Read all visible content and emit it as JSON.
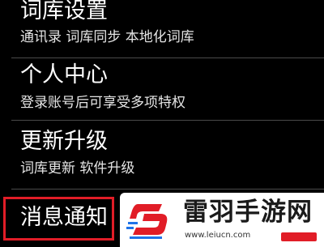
{
  "settings": {
    "dictionary": {
      "title": "词库设置",
      "subtitle": "通讯录 词库同步 本地化词库"
    },
    "personal_center": {
      "title": "个人中心",
      "subtitle": "登录账号后可享受多项特权"
    },
    "update": {
      "title": "更新升级",
      "subtitle": "词库更新 软件升级"
    },
    "notifications": {
      "title": "消息通知"
    }
  },
  "watermark": {
    "logo_icon": "leiyu-logo-icon",
    "name": "雷羽手游网",
    "url": "www.leiucn.com"
  },
  "colors": {
    "highlight": "#e11d27",
    "logo_red": "#e11d27",
    "logo_blue": "#1e73e8"
  }
}
